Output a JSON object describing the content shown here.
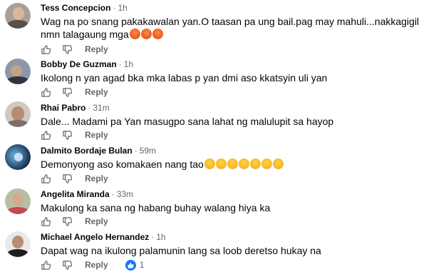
{
  "colors": {
    "like": "#1877f2",
    "muted": "#65676b",
    "text": "#050505"
  },
  "comments": [
    {
      "author": "Tess Concepcion",
      "time": "1h",
      "text_line1": "Wag na po snang pakakawalan yan.O taasan pa ung bail.pag may mahuli...nakkagigil",
      "text_line2": "nmn talagaung mga",
      "emojis": [
        "angry-emoji",
        "angry-emoji",
        "angry-emoji"
      ],
      "reply_label": "Reply"
    },
    {
      "author": "Bobby De Guzman",
      "time": "1h",
      "text_line1": "Ikolong n yan agad bka mka labas p yan dmi aso kkatsyin uli yan",
      "reply_label": "Reply"
    },
    {
      "author": "Rhai Pabro",
      "time": "31m",
      "text_line1": "Dale... Madami pa Yan masugpo sana lahat ng malulupit sa hayop",
      "reply_label": "Reply"
    },
    {
      "author": "Dalmito Bordaje Bulan",
      "time": "59m",
      "text_line1": "Demonyong aso komakaen nang tao",
      "emojis": [
        "rofl-emoji",
        "rofl-emoji",
        "rofl-emoji",
        "rofl-emoji",
        "rofl-emoji",
        "rofl-emoji",
        "rofl-emoji"
      ],
      "reply_label": "Reply"
    },
    {
      "author": "Angelita Miranda",
      "time": "33m",
      "text_line1": "Makulong ka sana ng habang buhay walang hiya ka",
      "reply_label": "Reply"
    },
    {
      "author": "Michael Angelo Hernandez",
      "time": "1h",
      "text_line1": "Dapat wag na ikulong palamunin lang sa loob deretso hukay na",
      "reply_label": "Reply",
      "reaction_icon": "like-icon",
      "reaction_count": "1"
    }
  ]
}
